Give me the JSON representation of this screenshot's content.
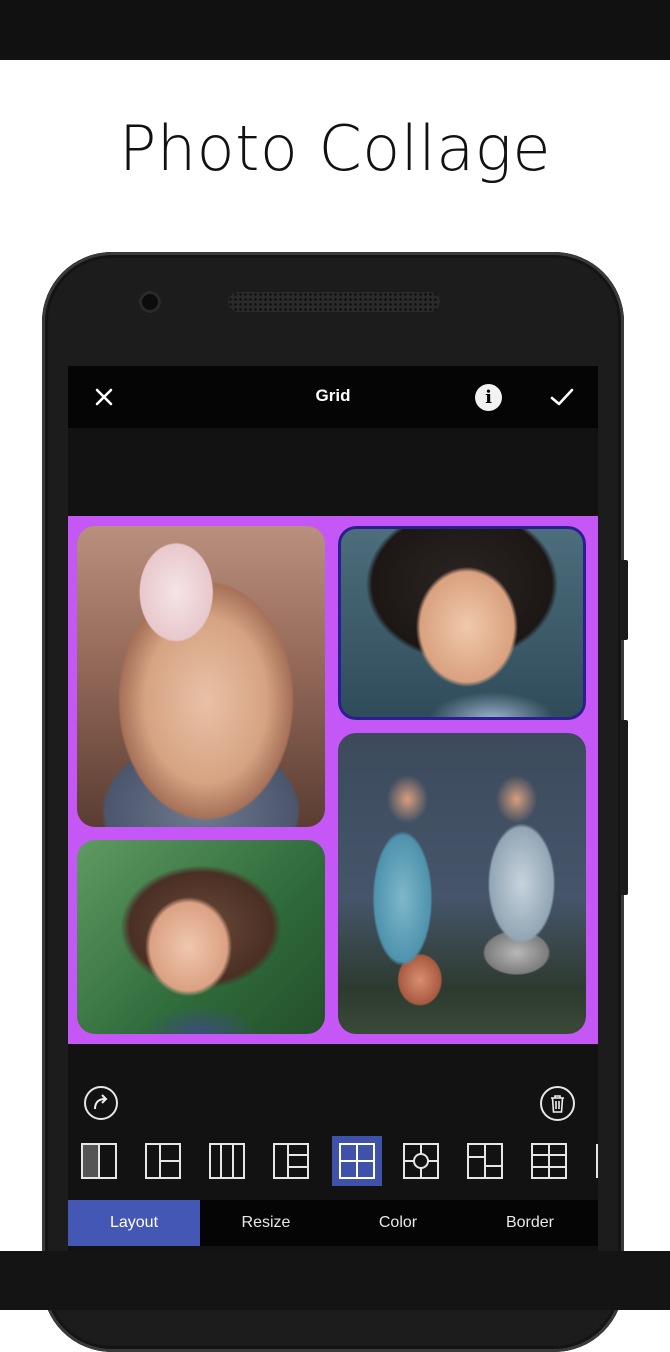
{
  "headline": "Photo Collage",
  "toolbar": {
    "title": "Grid",
    "info_glyph": "i",
    "close_icon": "close-icon",
    "info_icon": "info-icon",
    "confirm_icon": "check-icon"
  },
  "collage": {
    "background_color": "#c557f7",
    "cells": [
      {
        "name": "photo-girl-pink-hat"
      },
      {
        "name": "photo-boy-curly-hair"
      },
      {
        "name": "photo-two-kids-holding-hands"
      },
      {
        "name": "photo-girl-curly-hair"
      }
    ]
  },
  "controls": {
    "redo_icon": "redo-icon",
    "delete_icon": "trash-icon"
  },
  "layouts": {
    "selected_index": 4,
    "items": [
      "layout-split-vertical",
      "layout-left-plus-two-right",
      "layout-three-columns",
      "layout-left-plus-three-right",
      "layout-grid-2x2",
      "layout-grid-center-circle",
      "layout-grid-offset",
      "layout-grid-2x3",
      "layout-partial"
    ]
  },
  "tabs": {
    "items": [
      {
        "label": "Layout",
        "active": true
      },
      {
        "label": "Resize",
        "active": false
      },
      {
        "label": "Color",
        "active": false
      },
      {
        "label": "Border",
        "active": false
      }
    ]
  },
  "colors": {
    "accent": "#4557b4",
    "selected_layout": "#3d52a8",
    "collage_border": "#c557f7",
    "toolbar": "#050505"
  }
}
